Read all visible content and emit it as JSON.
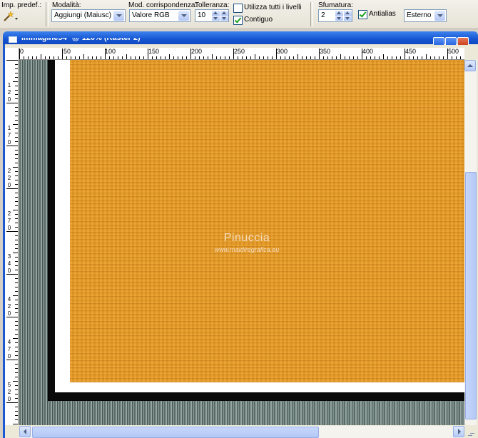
{
  "toolbar": {
    "preset_label": "Imp. predef.:",
    "mode_label": "Modalità:",
    "mode_value": "Aggiungi (Maiusc)",
    "match_label": "Mod. corrispondenza:",
    "match_value": "Valore RGB",
    "tolerance_label": "Tolleranza:",
    "tolerance_value": "10",
    "use_all_layers_label": "Utilizza tutti i livelli",
    "use_all_layers_checked": false,
    "contiguous_label": "Contiguo",
    "contiguous_checked": true,
    "feather_label": "Sfumatura:",
    "feather_value": "2",
    "antialias_label": "Antialias",
    "antialias_checked": true,
    "antialias_mode_value": "Esterno"
  },
  "window": {
    "title": "Immagine54* @ 120% (Raster 2)"
  },
  "ruler": {
    "h_labels": [
      "0",
      "50",
      "100",
      "150",
      "200",
      "250",
      "300",
      "350",
      "400",
      "450",
      "500"
    ],
    "v_labels": [
      "",
      "120",
      "170",
      "220",
      "270",
      "340",
      "420",
      "470",
      "520",
      "570"
    ]
  },
  "canvas": {
    "watermark_title": "Pinuccia",
    "watermark_url": "www.maidiregrafica.eu",
    "colors": {
      "orange": "#e89a24",
      "white_border": "#ffffff",
      "black_frame": "#0a0a0a",
      "stripes": "#7d8f8b"
    }
  },
  "icons": {
    "preset": "magic-wand-icon"
  }
}
